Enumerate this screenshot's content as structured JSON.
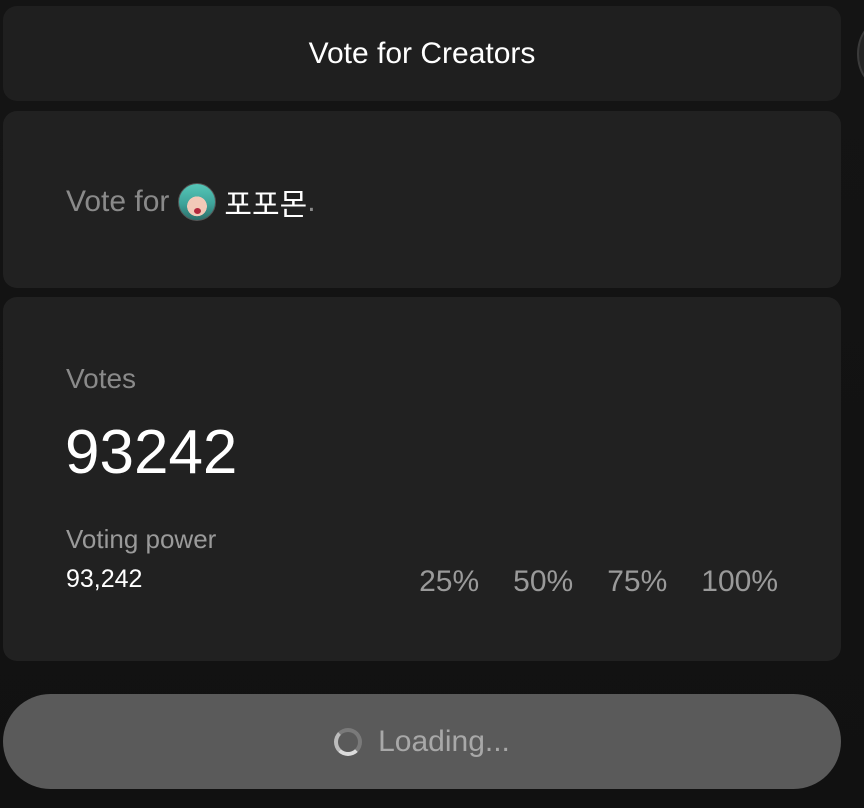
{
  "header": {
    "title": "Vote for Creators"
  },
  "target": {
    "prefix": "Vote for",
    "creator_name": "포포몬",
    "suffix": "."
  },
  "stats": {
    "votes_label": "Votes",
    "votes_value": "93242",
    "voting_power_label": "Voting power",
    "voting_power_value": "93,242",
    "percent_options": [
      "25%",
      "50%",
      "75%",
      "100%"
    ]
  },
  "submit": {
    "label": "Loading..."
  },
  "colors": {
    "card_background": "#212121",
    "page_background": "#111111",
    "button_background": "#5a5a5a",
    "muted_text": "#8a8a8a",
    "primary_text": "#ffffff"
  }
}
